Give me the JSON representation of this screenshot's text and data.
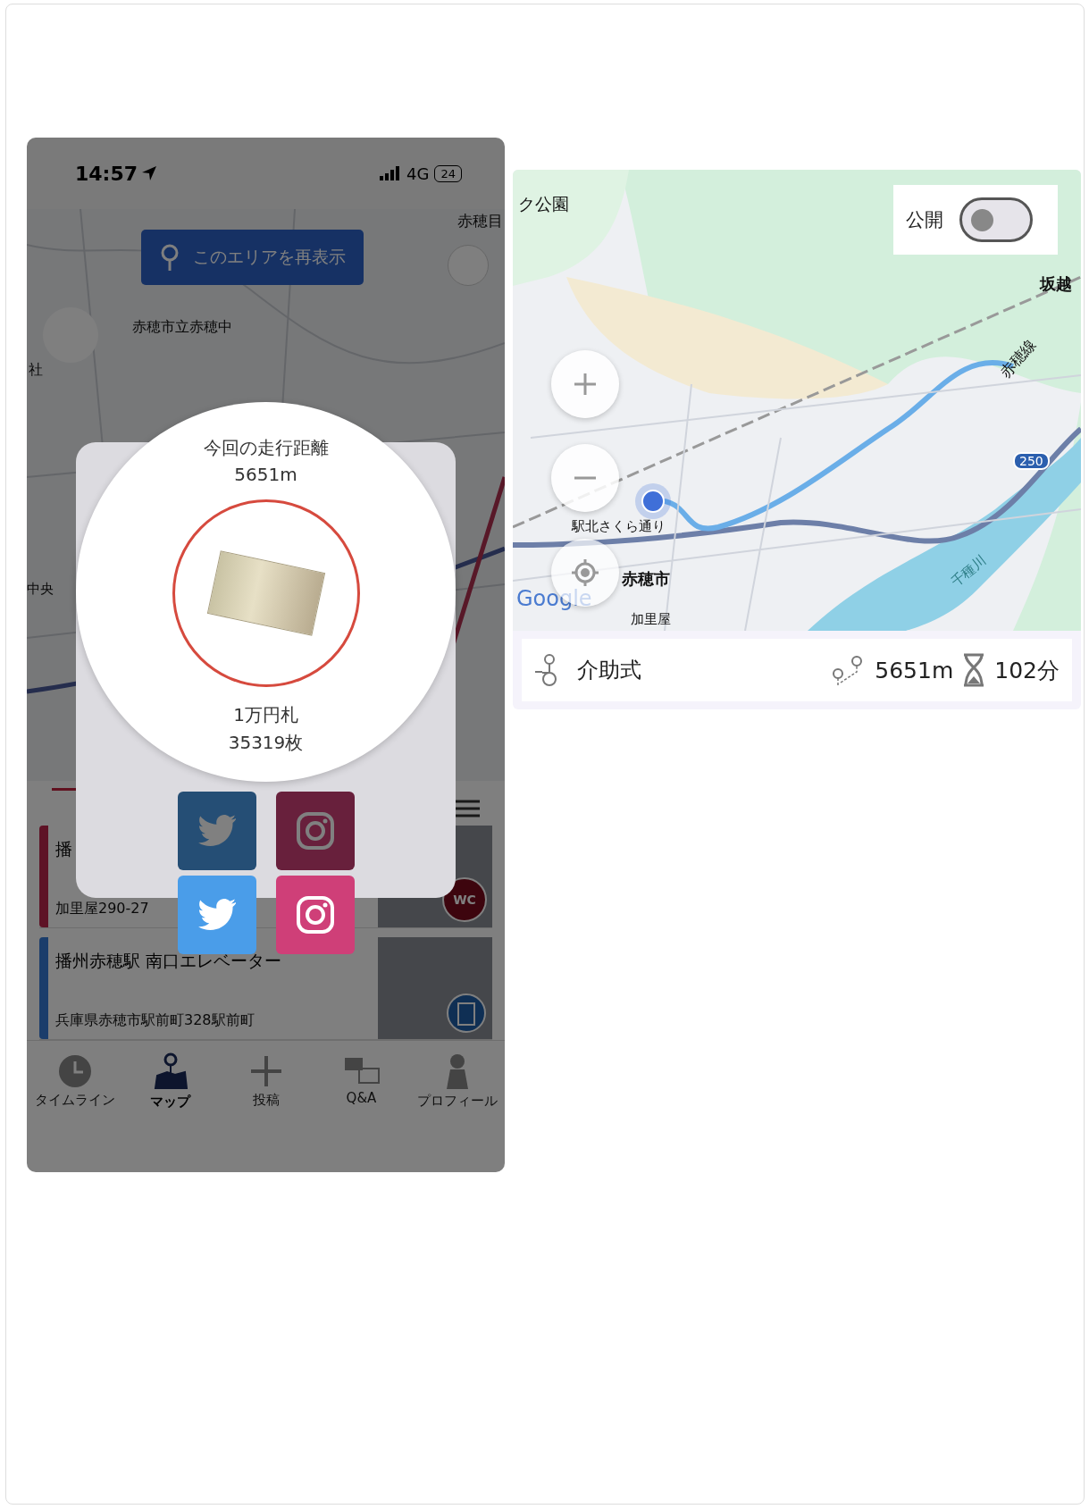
{
  "phone": {
    "status_bar": {
      "time": "14:57",
      "network": "4G",
      "battery": "24"
    },
    "map": {
      "reload_button": "このエリアを再表示",
      "labels": [
        "赤穂目",
        "赤穂市立赤穂中",
        "社",
        "中央"
      ]
    },
    "list": [
      {
        "title": "播",
        "address": "加里屋290-27",
        "color": "#5e1326",
        "badge": "WC"
      },
      {
        "title": "播州赤穂駅 南口エレベーター",
        "address": "兵庫県赤穂市駅前町328駅前町",
        "color": "#1b3d6b"
      }
    ],
    "tabs": [
      {
        "label": "タイムライン",
        "kind": "clock",
        "selected": false
      },
      {
        "label": "マップ",
        "kind": "map",
        "selected": true
      },
      {
        "label": "投稿",
        "kind": "plus",
        "selected": false
      },
      {
        "label": "Q&A",
        "kind": "qa",
        "selected": false
      },
      {
        "label": "プロフィール",
        "kind": "person",
        "selected": false
      }
    ],
    "result_popup": {
      "title": "今回の走行距離",
      "distance": "5651m",
      "item": "1万円札",
      "count": "35319枚",
      "share_buttons": [
        {
          "kind": "twitter",
          "dimmed": true
        },
        {
          "kind": "instagram",
          "dimmed": true
        },
        {
          "kind": "twitter",
          "dimmed": false
        },
        {
          "kind": "instagram",
          "dimmed": false
        }
      ]
    }
  },
  "route_card": {
    "map": {
      "labels": [
        "ク公園",
        "坂越",
        "赤穂線",
        "駅北さくら通り",
        "赤穂市",
        "千種川",
        "加里屋",
        "250",
        "Google"
      ]
    },
    "public_toggle": {
      "label": "公開",
      "on": false
    },
    "mode": "介助式",
    "distance": "5651m",
    "duration": "102分"
  }
}
